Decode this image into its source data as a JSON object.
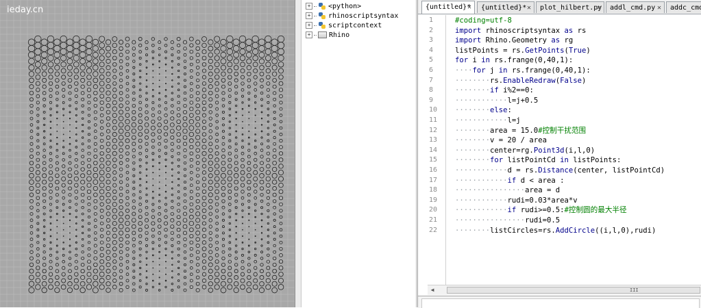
{
  "watermark": "ieday.cn",
  "viewport": {
    "background_color": "#a8a8a8",
    "grid_color": "#bdbdbd",
    "circle_stroke_color": "#1f1f1f",
    "columns": 40,
    "rows": 40,
    "max_radius": 0.5,
    "content": "grid of circles generated by the script"
  },
  "tree": {
    "items": [
      {
        "label": "<python>",
        "icon": "python-icon"
      },
      {
        "label": "rhinoscriptsyntax",
        "icon": "python-icon"
      },
      {
        "label": "scriptcontext",
        "icon": "python-icon"
      },
      {
        "label": "Rhino",
        "icon": "rhino-module-icon"
      }
    ]
  },
  "tabs": [
    {
      "label": "{untitled}*",
      "active": true
    },
    {
      "label": "{untitled}*",
      "active": false
    },
    {
      "label": "plot_hilbert.py",
      "active": false
    },
    {
      "label": "addl_cmd.py",
      "active": false
    },
    {
      "label": "addc_cmd.py",
      "active": false
    }
  ],
  "editor": {
    "line_numbers": [
      "1",
      "2",
      "3",
      "4",
      "5",
      "6",
      "7",
      "8",
      "9",
      "10",
      "11",
      "12",
      "13",
      "14",
      "15",
      "16",
      "17",
      "18",
      "19",
      "20",
      "21",
      "22"
    ],
    "colors": {
      "keyword": "#00008b",
      "comment": "#008000",
      "text": "#000000"
    },
    "lines": [
      [
        [
          "#coding=utf-8",
          "cm"
        ]
      ],
      [
        [
          "import",
          "kw"
        ],
        [
          " rhinoscriptsyntax ",
          ""
        ],
        [
          "as",
          "kw"
        ],
        [
          " rs",
          ""
        ]
      ],
      [
        [
          "import",
          "kw"
        ],
        [
          " Rhino.Geometry ",
          ""
        ],
        [
          "as",
          "kw"
        ],
        [
          " rg",
          ""
        ]
      ],
      [
        [
          "listPoints = rs.",
          ""
        ],
        [
          "GetPoints",
          "fn"
        ],
        [
          "(",
          ""
        ],
        [
          "True",
          "kw"
        ],
        [
          ")",
          ""
        ]
      ],
      [
        [
          "for",
          "kw"
        ],
        [
          " i ",
          ""
        ],
        [
          "in",
          "kw"
        ],
        [
          " rs.frange(0,40,1):",
          ""
        ]
      ],
      [
        [
          "····",
          "vd"
        ],
        [
          "for",
          "kw"
        ],
        [
          " j ",
          ""
        ],
        [
          "in",
          "kw"
        ],
        [
          " rs.frange(0,40,1):",
          ""
        ]
      ],
      [
        [
          "········",
          "vd"
        ],
        [
          "rs.",
          ""
        ],
        [
          "EnableRedraw",
          "fn"
        ],
        [
          "(",
          ""
        ],
        [
          "False",
          "kw"
        ],
        [
          ")",
          ""
        ]
      ],
      [
        [
          "········",
          "vd"
        ],
        [
          "if",
          "kw"
        ],
        [
          " i%2==0:",
          ""
        ]
      ],
      [
        [
          "············",
          "vd"
        ],
        [
          "l=j+0.5",
          ""
        ]
      ],
      [
        [
          "········",
          "vd"
        ],
        [
          "else",
          "kw"
        ],
        [
          ":",
          ""
        ]
      ],
      [
        [
          "············",
          "vd"
        ],
        [
          "l=j",
          ""
        ]
      ],
      [
        [
          "········",
          "vd"
        ],
        [
          "area = 15.0",
          ""
        ],
        [
          "#控制干扰范围",
          "cm"
        ]
      ],
      [
        [
          "········",
          "vd"
        ],
        [
          "v = 20 / area",
          ""
        ]
      ],
      [
        [
          "········",
          "vd"
        ],
        [
          "center=rg.",
          ""
        ],
        [
          "Point3d",
          "fn"
        ],
        [
          "(i,l,0)",
          ""
        ]
      ],
      [
        [
          "········",
          "vd"
        ],
        [
          "for",
          "kw"
        ],
        [
          " listPointCd ",
          ""
        ],
        [
          "in",
          "kw"
        ],
        [
          " listPoints:",
          ""
        ]
      ],
      [
        [
          "············",
          "vd"
        ],
        [
          "d = rs.",
          ""
        ],
        [
          "Distance",
          "fn"
        ],
        [
          "(center, listPointCd)",
          ""
        ]
      ],
      [
        [
          "············",
          "vd"
        ],
        [
          "if",
          "kw"
        ],
        [
          " d < area :",
          ""
        ]
      ],
      [
        [
          "················",
          "vd"
        ],
        [
          "area = d",
          ""
        ]
      ],
      [
        [
          "············",
          "vd"
        ],
        [
          "rudi=0.03*area*v",
          ""
        ]
      ],
      [
        [
          "············",
          "vd"
        ],
        [
          "if",
          "kw"
        ],
        [
          " rudi>=0.5:",
          ""
        ],
        [
          "#控制圆的最大半径",
          "cm"
        ]
      ],
      [
        [
          "················",
          "vd"
        ],
        [
          "rudi=0.5",
          ""
        ]
      ],
      [
        [
          "········",
          "vd"
        ],
        [
          "listCircles=rs.",
          ""
        ],
        [
          "AddCircle",
          "fn"
        ],
        [
          "((i,l,0),rudi)",
          ""
        ]
      ]
    ]
  },
  "scrollbar": {
    "grip": "III"
  }
}
